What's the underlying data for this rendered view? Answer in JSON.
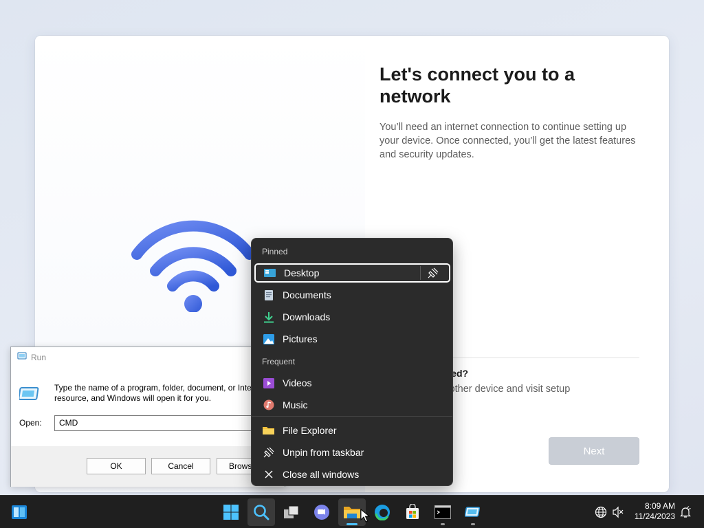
{
  "oobe": {
    "title": "Let's connect you to a network",
    "description": "You’ll need an internet connection to continue setting up your device. Once connected, you’ll get the latest features and security updates.",
    "help_title": "getting connected?",
    "help_text": "ting tips, use another device and visit setup",
    "next_label": "Next"
  },
  "run": {
    "title": "Run",
    "description": "Type the name of a program, folder, document, or Internet resource, and Windows will open it for you.",
    "open_label": "Open:",
    "input_value": "CMD",
    "ok_label": "OK",
    "cancel_label": "Cancel",
    "browse_label": "Browse..."
  },
  "jumplist": {
    "pinned_header": "Pinned",
    "frequent_header": "Frequent",
    "pinned": [
      {
        "label": "Desktop",
        "icon": "desktop-icon"
      },
      {
        "label": "Documents",
        "icon": "documents-icon"
      },
      {
        "label": "Downloads",
        "icon": "downloads-icon"
      },
      {
        "label": "Pictures",
        "icon": "pictures-icon"
      }
    ],
    "frequent": [
      {
        "label": "Videos",
        "icon": "videos-icon"
      },
      {
        "label": "Music",
        "icon": "music-icon"
      }
    ],
    "actions": [
      {
        "label": "File Explorer",
        "icon": "file-explorer-icon"
      },
      {
        "label": "Unpin from taskbar",
        "icon": "unpin-icon"
      },
      {
        "label": "Close all windows",
        "icon": "close-icon"
      }
    ]
  },
  "taskbar": {
    "time": "8:09 AM",
    "date": "11/24/2023",
    "accent": "#4cc2ff"
  },
  "colors": {
    "wifi_gradient_start": "#6a86f0",
    "wifi_gradient_end": "#2f5fd8",
    "next_disabled": "#c9ced6"
  }
}
